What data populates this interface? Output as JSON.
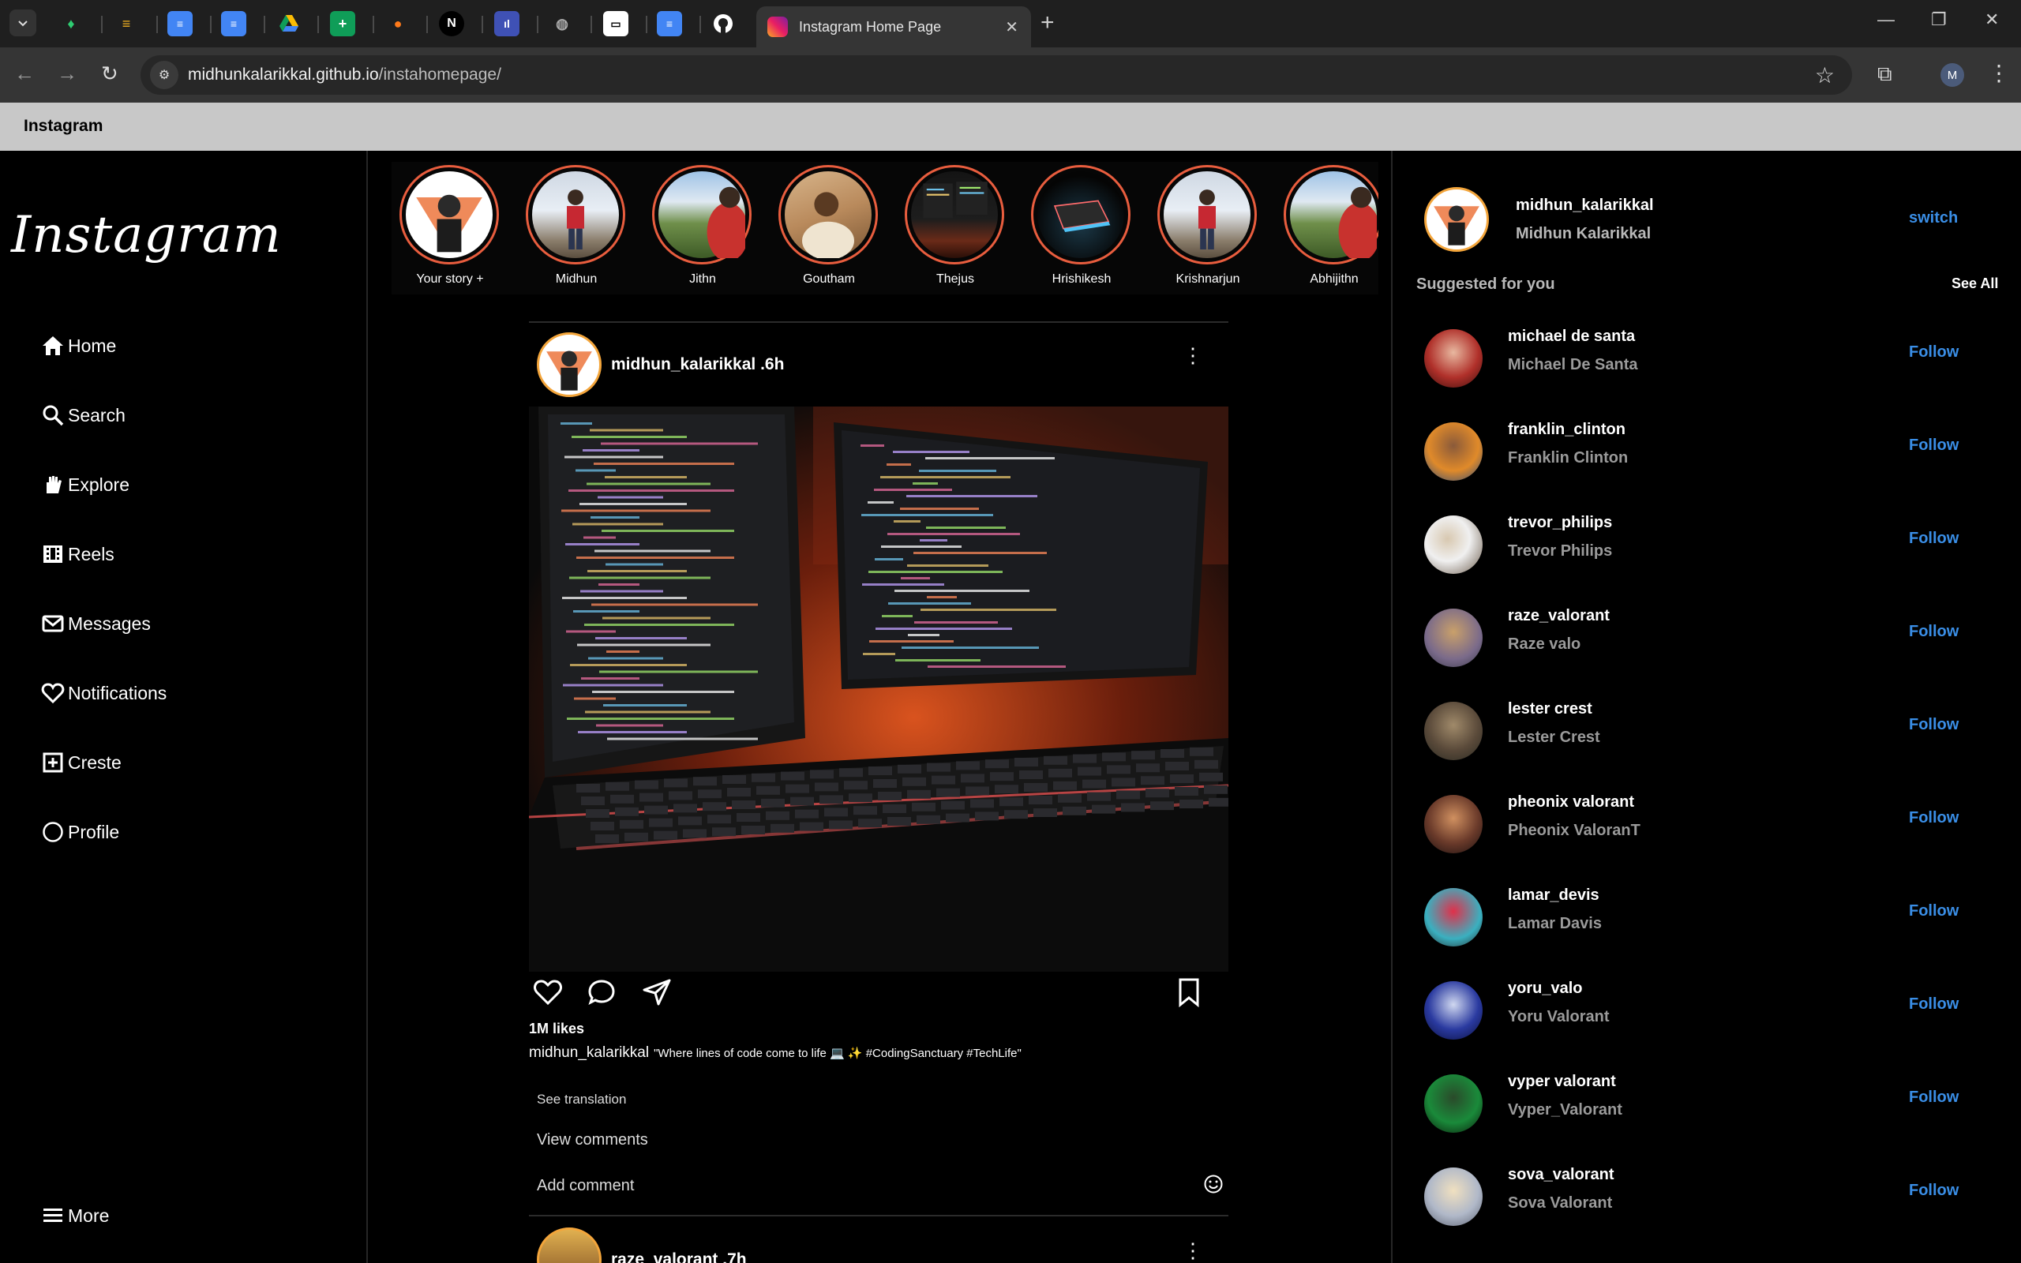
{
  "browser": {
    "active_tab_title": "Instagram Home Page",
    "url_host": "midhunkalarikkal.github.io",
    "url_path": "/instahomepage/",
    "profile_initial": "M",
    "page_title_bar": "Instagram"
  },
  "sidebar": {
    "brand": "Instagram",
    "items": [
      {
        "label": "Home",
        "icon": "home-icon"
      },
      {
        "label": "Search",
        "icon": "search-icon"
      },
      {
        "label": "Explore",
        "icon": "explore-icon"
      },
      {
        "label": "Reels",
        "icon": "reels-icon"
      },
      {
        "label": "Messages",
        "icon": "messages-icon"
      },
      {
        "label": "Notifications",
        "icon": "heart-icon"
      },
      {
        "label": "Creste",
        "icon": "create-icon"
      },
      {
        "label": "Profile",
        "icon": "profile-icon"
      }
    ],
    "more_label": "More"
  },
  "stories": [
    {
      "name": "Your story +"
    },
    {
      "name": "Midhun"
    },
    {
      "name": "Jithn"
    },
    {
      "name": "Goutham"
    },
    {
      "name": "Thejus"
    },
    {
      "name": "Hrishikesh"
    },
    {
      "name": "Krishnarjun"
    },
    {
      "name": "Abhijithn"
    }
  ],
  "post": {
    "user_time": "midhun_kalarikkal .6h",
    "likes": "1M likes",
    "caption_user": "midhun_kalarikkal",
    "caption_text": "\"Where lines of code come to life 💻 ✨ #CodingSanctuary #TechLife\"",
    "see_translation": "See translation",
    "view_comments": "View comments",
    "add_comment_placeholder": "Add comment"
  },
  "post2": {
    "user_time": "raze_valorant .7h"
  },
  "right_panel": {
    "username": "midhun_kalarikkal",
    "fullname": "Midhun Kalarikkal",
    "switch_label": "switch",
    "suggested_title": "Suggested for you",
    "see_all": "See All",
    "follow_label": "Follow",
    "suggestions": [
      {
        "username": "michael de santa",
        "name": "Michael De Santa"
      },
      {
        "username": "franklin_clinton",
        "name": "Franklin Clinton"
      },
      {
        "username": "trevor_philips",
        "name": "Trevor Philips"
      },
      {
        "username": "raze_valorant",
        "name": "Raze valo"
      },
      {
        "username": "lester crest",
        "name": "Lester Crest"
      },
      {
        "username": "pheonix valorant",
        "name": "Pheonix ValoranT"
      },
      {
        "username": "lamar_devis",
        "name": "Lamar Davis"
      },
      {
        "username": "yoru_valo",
        "name": "Yoru Valorant"
      },
      {
        "username": "vyper valorant",
        "name": "Vyper_Valorant"
      },
      {
        "username": "sova_valorant",
        "name": "Sova Valorant"
      }
    ]
  },
  "colors": {
    "link_blue": "#3a8ee6",
    "story_ring": "#e85d3e",
    "avatar_ring": "#f3a53b"
  }
}
